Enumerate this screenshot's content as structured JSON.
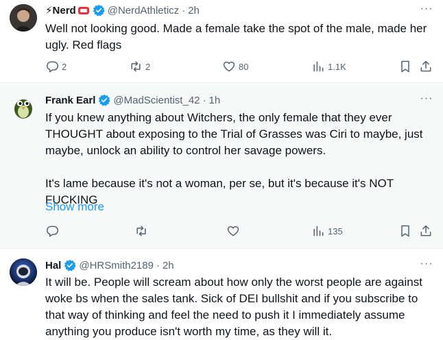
{
  "tweets": [
    {
      "name": "⚡Nerd",
      "handle": "@NerdAthleticz",
      "time": "2h",
      "text": "Well not looking good. Made a female take the spot of the male, made her ugly. Red flags",
      "replies": "2",
      "retweets": "2",
      "likes": "80",
      "views": "1.1K"
    },
    {
      "name": "Frank Earl",
      "handle": "@MadScientist_42",
      "time": "1h",
      "text_p1": "If you knew anything about Witchers, the only female that they ever THOUGHT about exposing to the Trial of Grasses was Ciri to maybe, just maybe, unlock an ability to control her savage powers.",
      "text_p2": "It's lame because it's not a woman, per se, but  it's because it's NOT FUCKING",
      "show_more": "Show more",
      "views": "135"
    },
    {
      "name": "Hal",
      "handle": "@HRSmith2189",
      "time": "2h",
      "text": "It will be. People will scream about how only the worst people are against woke bs when the sales tank. Sick of DEI bullshit and if you subscribe to that way of thinking and feel the need to push it I immediately assume anything you produce isn't worth my time, as they will it."
    }
  ],
  "separator_dot": "·",
  "more_glyph": "···",
  "colors": {
    "accent": "#1d9bf0",
    "muted": "#536471",
    "highlight_bg": "#f7f9f9"
  }
}
